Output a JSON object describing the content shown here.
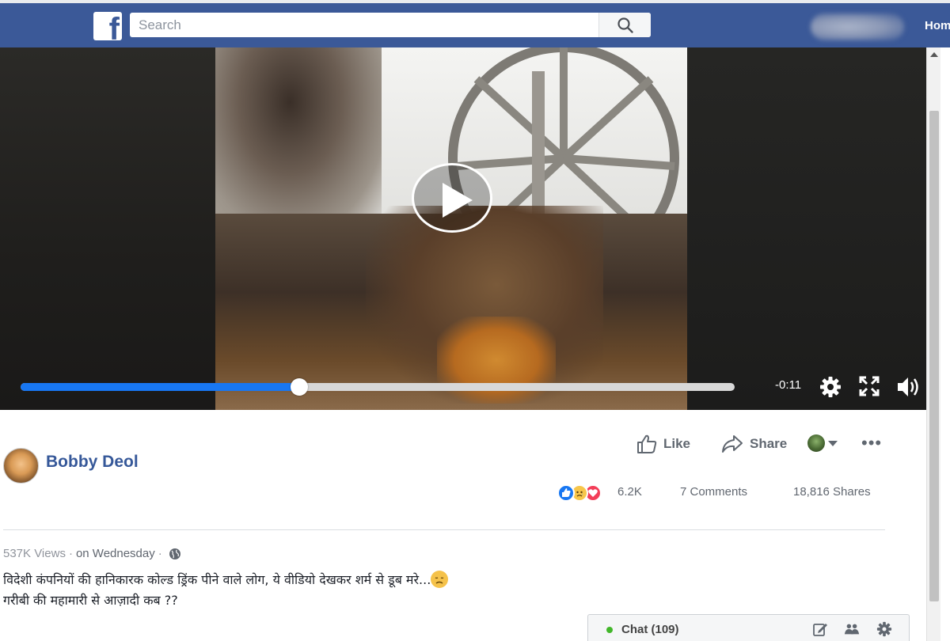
{
  "header": {
    "search_placeholder": "Search",
    "home_label": "Home",
    "brand_color": "#3b5998"
  },
  "video": {
    "time_remaining": "-0:11",
    "progress_percent": 39
  },
  "post": {
    "author": "Bobby Deol",
    "actions": {
      "like": "Like",
      "share": "Share"
    },
    "reactions_count": "6.2K",
    "comments": "7 Comments",
    "shares": "18,816 Shares",
    "views": "537K Views",
    "separator": "·",
    "posted": "on Wednesday",
    "caption_line1": "विदेशी कंपनियों की हानिकारक कोल्ड ड्रिंक पीने वाले लोग, ये वीडियो देखकर शर्म से डूब मरे...",
    "caption_line2": "गरीबी की महामारी से आज़ादी कब ??"
  },
  "chat": {
    "label": "Chat (109)"
  }
}
